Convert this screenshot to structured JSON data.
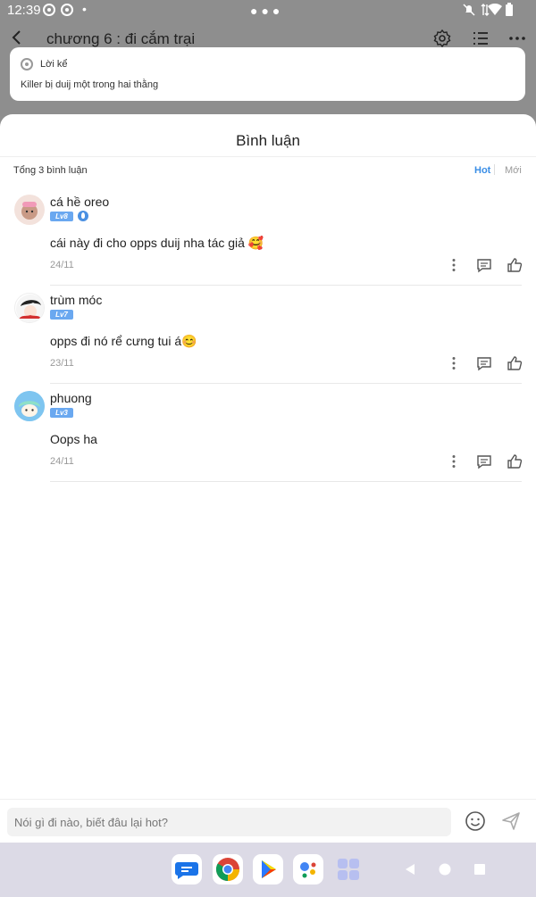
{
  "status_bar": {
    "time": "12:39"
  },
  "reader": {
    "chapter_title": "chương 6 : đi cắm trại"
  },
  "narration": {
    "label": "Lời kể",
    "text": "Killer bị duij một trong hai thằng"
  },
  "comments_sheet": {
    "title": "Bình luận",
    "total": "Tổng 3 bình luận",
    "sort_hot": "Hot",
    "sort_new": "Mới",
    "comments": [
      {
        "name": "cá hề oreo",
        "level": "Lv8",
        "text": "cái này đi cho opps duij nha tác giả 🥰",
        "date": "24/11"
      },
      {
        "name": "trùm móc",
        "level": "Lv7",
        "text": "opps đi nó rể cưng tui á😊",
        "date": "23/11"
      },
      {
        "name": "phuong",
        "level": "Lv3",
        "text": "Oops ha",
        "date": "24/11"
      }
    ]
  },
  "input": {
    "placeholder": "Nói gì đi nào, biết đâu lại hot?"
  },
  "colors": {
    "accent": "#3a8ee6",
    "level_badge": "#6aa8f0",
    "overlay": "#8e8e8e"
  }
}
